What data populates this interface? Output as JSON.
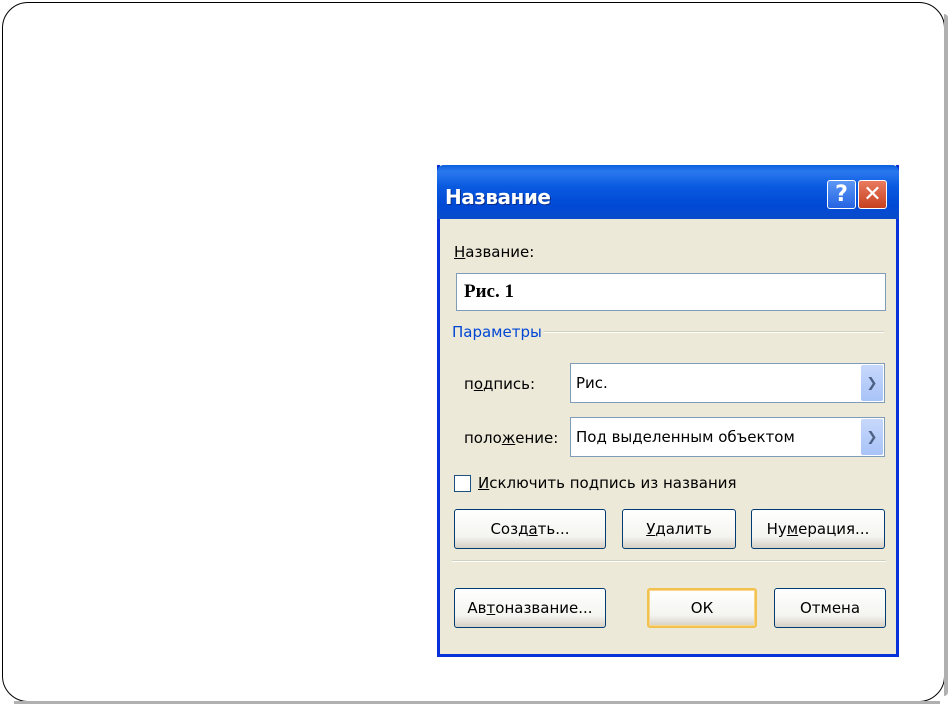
{
  "dialog": {
    "title": "Название",
    "help_symbol": "?",
    "close_symbol": "✕"
  },
  "caption": {
    "label_first": "Н",
    "label_rest": "азвание:",
    "value": "Рис. 1"
  },
  "params": {
    "group_label": "Параметры",
    "label_field": {
      "label_a": "п",
      "label_u": "о",
      "label_b": "дпись:",
      "value": "Рис."
    },
    "position_field": {
      "label_a": "поло",
      "label_u": "ж",
      "label_b": "ение:",
      "value": "Под выделенным объектом"
    }
  },
  "exclude": {
    "label_u": "И",
    "label_rest": "сключить подпись из названия",
    "checked": false
  },
  "buttons": {
    "create": {
      "a": "Созд",
      "u": "а",
      "b": "ть..."
    },
    "delete": {
      "a": "",
      "u": "У",
      "b": "далить"
    },
    "numbering": {
      "a": "Ну",
      "u": "м",
      "b": "ерация..."
    },
    "autocaption": {
      "a": "Ав",
      "u": "т",
      "b": "оназвание..."
    },
    "ok": "ОК",
    "cancel": "Отмена"
  },
  "icons": {
    "help": "help-icon",
    "close": "close-icon",
    "dropdown": "chevron-down-icon"
  },
  "colors": {
    "titlebar": "#0a5ae0",
    "dialog_bg": "#ece9d8",
    "group_label": "#0046d5",
    "close": "#c7401f",
    "ok_border": "#f2c14e"
  }
}
